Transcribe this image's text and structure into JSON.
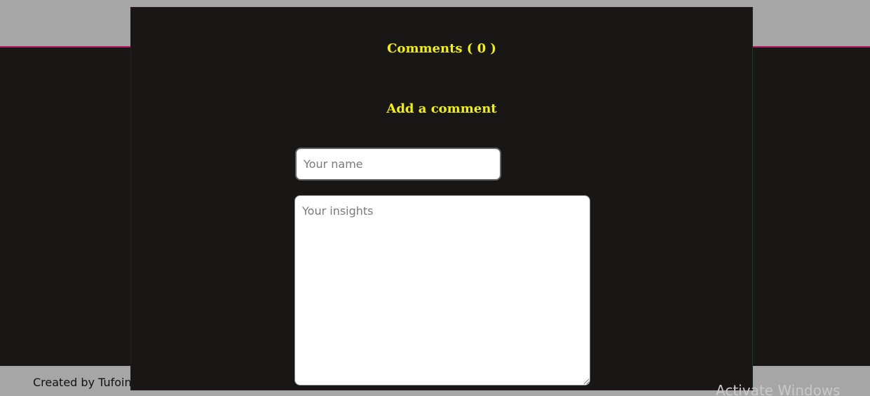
{
  "footer": {
    "created_by": "Created by Tufoin"
  },
  "overlay": {
    "watermark": "Activate Windows"
  },
  "comments_modal": {
    "title": "Comments ( 0 )",
    "add_heading": "Add a comment",
    "name_placeholder": "Your name",
    "insights_placeholder": "Your insights"
  },
  "colors": {
    "heading": "#f3f300",
    "background_dark": "#181716",
    "page_gray": "#a6a6a6",
    "accent_line": "#b0165f"
  }
}
